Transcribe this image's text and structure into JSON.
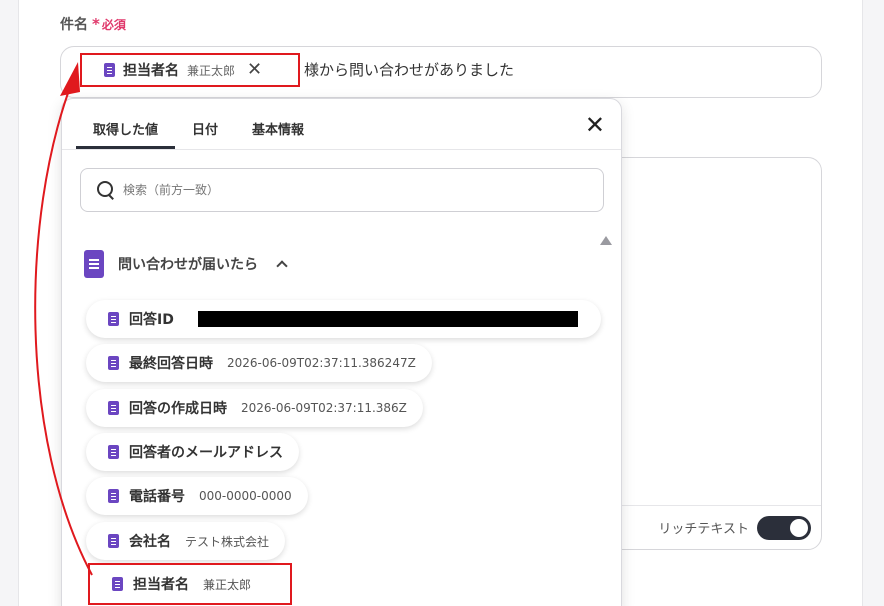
{
  "subject_field": {
    "label": "件名",
    "required_mark": "*",
    "required_label": "必須",
    "chip": {
      "name": "担当者名",
      "value": "兼正太郎",
      "close_glyph": "✕"
    },
    "text_after_chip": "様から問い合わせがありました"
  },
  "body_field": {
    "rich_text_label": "リッチテキスト",
    "rich_text_enabled": true
  },
  "popup": {
    "tabs": [
      {
        "label": "取得した値",
        "active": true
      },
      {
        "label": "日付",
        "active": false
      },
      {
        "label": "基本情報",
        "active": false
      }
    ],
    "close_glyph": "✕",
    "search": {
      "placeholder": "検索（前方一致）"
    },
    "group": {
      "title": "問い合わせが届いたら"
    },
    "items": [
      {
        "name": "回答ID",
        "value": ""
      },
      {
        "name": "最終回答日時",
        "value": "2026-06-09T02:37:11.386247Z"
      },
      {
        "name": "回答の作成日時",
        "value": "2026-06-09T02:37:11.386Z"
      },
      {
        "name": "回答者のメールアドレス",
        "value": ""
      },
      {
        "name": "電話番号",
        "value": "000-0000-0000"
      },
      {
        "name": "会社名",
        "value": "テスト株式会社"
      },
      {
        "name": "担当者名",
        "value": "兼正太郎"
      }
    ]
  },
  "colors": {
    "accent": "#6b46c1",
    "highlight": "#e0191e",
    "required": "#e0386b"
  }
}
